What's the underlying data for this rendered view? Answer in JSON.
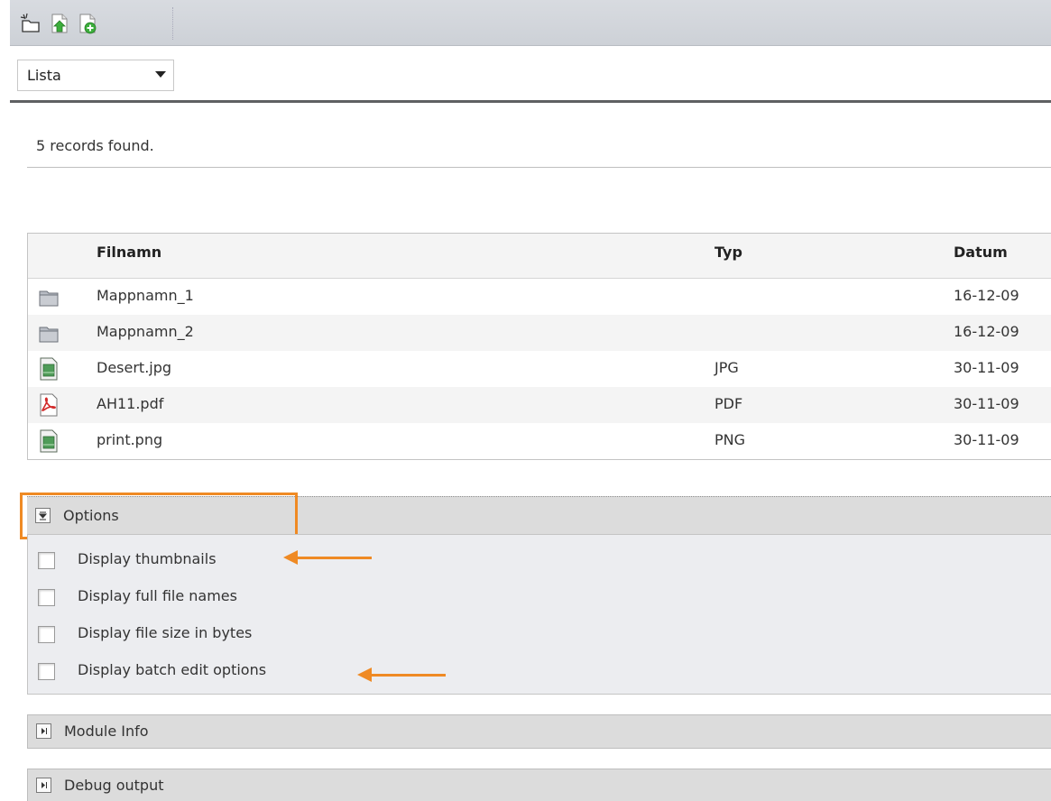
{
  "toolbar": {
    "icons": [
      "new-folder-icon",
      "upload-file-icon",
      "create-file-icon"
    ]
  },
  "view_select": {
    "value": "Lista"
  },
  "records": {
    "text": "5 records found."
  },
  "table": {
    "headers": {
      "name": "Filnamn",
      "type": "Typ",
      "date": "Datum"
    },
    "rows": [
      {
        "icon": "folder-icon",
        "name": "Mappnamn_1",
        "type": "",
        "date": "16-12-09"
      },
      {
        "icon": "folder-icon",
        "name": "Mappnamn_2",
        "type": "",
        "date": "16-12-09"
      },
      {
        "icon": "image-file-icon",
        "name": "Desert.jpg",
        "type": "JPG",
        "date": "30-11-09"
      },
      {
        "icon": "pdf-file-icon",
        "name": "AH11.pdf",
        "type": "PDF",
        "date": "30-11-09"
      },
      {
        "icon": "image-file-icon",
        "name": "print.png",
        "type": "PNG",
        "date": "30-11-09"
      }
    ]
  },
  "options": {
    "title": "Options",
    "items": [
      {
        "label": "Display thumbnails",
        "checked": false
      },
      {
        "label": "Display full file names",
        "checked": false
      },
      {
        "label": "Display file size in bytes",
        "checked": false
      },
      {
        "label": "Display batch edit options",
        "checked": false
      }
    ]
  },
  "module_info": {
    "title": "Module Info"
  },
  "debug_output": {
    "title": "Debug output"
  },
  "colors": {
    "highlight": "#ef8a24",
    "header_rule": "#5f6062",
    "panel_bg": "#ecedf0"
  }
}
